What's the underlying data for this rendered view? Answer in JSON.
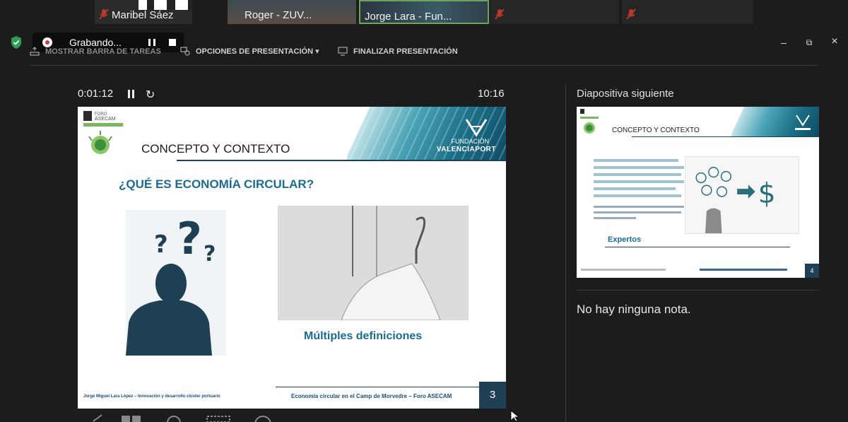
{
  "participants": [
    {
      "name": "Maribel Sáez",
      "muted": true
    },
    {
      "name": "Roger - ZUV...",
      "muted": false
    },
    {
      "name": "Jorge Lara - Fun...",
      "muted": false,
      "active": true
    },
    {
      "name": "",
      "muted": true
    },
    {
      "name": "",
      "muted": true
    }
  ],
  "recording": {
    "label": "Grabando..."
  },
  "toolbar": {
    "show_taskbar": "MOSTRAR BARRA DE TAREAS",
    "presentation_options": "OPCIONES DE PRESENTACIÓN ▾",
    "end_presentation": "FINALIZAR PRESENTACIÓN"
  },
  "window_controls": {
    "minimize": "–",
    "restore": "⧉",
    "close": "×"
  },
  "presenter": {
    "elapsed": "0:01:12",
    "clock": "10:16"
  },
  "current_slide": {
    "section_title": "CONCEPTO Y CONTEXTO",
    "question": "¿QUÉ ES ECONOMÍA CIRCULAR?",
    "caption": "Múltiples definiciones",
    "foundation_top": "FUNDACIÓN",
    "foundation_name": "VALENCIAPORT",
    "footer_left": "Jorge Miguel Lara López – Innovación y desarrollo clúster portuario",
    "footer_right": "Economía circular en el Camp de Morvedre – Foro ASECAM",
    "number": "3"
  },
  "next_slide": {
    "label": "Diapositiva siguiente",
    "section_title": "CONCEPTO Y CONTEXTO",
    "caption": "Expertos",
    "number": "4"
  },
  "notes": {
    "text": "No hay ninguna nota."
  },
  "colors": {
    "slide_accent": "#1a6c93",
    "slide_dark": "#1f3f55",
    "background": "#1c1c1c"
  }
}
